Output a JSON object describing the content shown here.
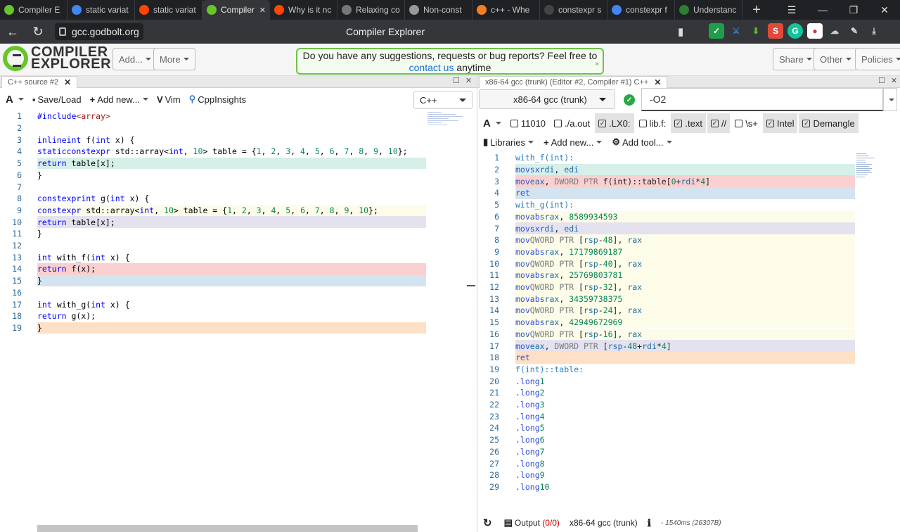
{
  "browser": {
    "tabs": [
      {
        "title": "Compiler E",
        "icon": "compiler-explorer-icon",
        "color": "#67c52a",
        "active": false
      },
      {
        "title": "static variat",
        "icon": "google-icon",
        "color": "#4285f4",
        "active": false
      },
      {
        "title": "static variat",
        "icon": "reddit-icon",
        "color": "#ff4500",
        "active": false
      },
      {
        "title": "Compiler",
        "icon": "compiler-explorer-icon",
        "color": "#67c52a",
        "active": true
      },
      {
        "title": "Why is it nc",
        "icon": "reddit-icon",
        "color": "#ff4500",
        "active": false
      },
      {
        "title": "Relaxing co",
        "icon": "isocpp-icon",
        "color": "#777777",
        "active": false
      },
      {
        "title": "Non-const",
        "icon": "document-icon",
        "color": "#999999",
        "active": false
      },
      {
        "title": "c++ - Whe",
        "icon": "stackoverflow-icon",
        "color": "#f48024",
        "active": false
      },
      {
        "title": "constexpr s",
        "icon": "github-icon",
        "color": "#444444",
        "active": false
      },
      {
        "title": "constexpr f",
        "icon": "google-icon",
        "color": "#4285f4",
        "active": false
      },
      {
        "title": "Understanc",
        "icon": "dg-icon",
        "color": "#2e7d32",
        "active": false
      }
    ],
    "url": "gcc.godbolt.org",
    "page_title": "Compiler Explorer"
  },
  "header": {
    "logo_line1": "COMPILER",
    "logo_line2": "EXPLORER",
    "add_label": "Add...",
    "more_label": "More",
    "notice_text": "Do you have any suggestions, requests or bug reports? Feel free to",
    "notice_link": "contact us",
    "notice_tail": "anytime",
    "notice_close": "×",
    "share_label": "Share",
    "other_label": "Other",
    "policies_label": "Policies"
  },
  "left": {
    "tab_title": "C++ source #2",
    "toolbar": {
      "font_label": "A",
      "save_label": "Save/Load",
      "addnew_label": "Add new...",
      "vim_label": "Vim",
      "insights_label": "CppInsights",
      "language": "C++"
    },
    "lines": [
      {
        "n": "1",
        "t": "#include <array>",
        "bg": ""
      },
      {
        "n": "2",
        "t": "",
        "bg": ""
      },
      {
        "n": "3",
        "t": "inline int f(int x) {",
        "bg": ""
      },
      {
        "n": "4",
        "t": "    static constexpr std::array<int, 10> table = {1, 2, 3, 4, 5, 6, 7, 8, 9, 10};",
        "bg": ""
      },
      {
        "n": "5",
        "t": "    return table[x];",
        "bg": "#d6efe9"
      },
      {
        "n": "6",
        "t": "}",
        "bg": ""
      },
      {
        "n": "7",
        "t": "",
        "bg": ""
      },
      {
        "n": "8",
        "t": "constexpr int g(int x) {",
        "bg": ""
      },
      {
        "n": "9",
        "t": "    constexpr std::array<int, 10> table = {1, 2, 3, 4, 5, 6, 7, 8, 9, 10};",
        "bg": "#fcfce8"
      },
      {
        "n": "10",
        "t": "    return table[x];",
        "bg": "#e4e2ef"
      },
      {
        "n": "11",
        "t": "}",
        "bg": ""
      },
      {
        "n": "12",
        "t": "",
        "bg": ""
      },
      {
        "n": "13",
        "t": "int with_f(int x) {",
        "bg": ""
      },
      {
        "n": "14",
        "t": "    return f(x);",
        "bg": "#f9d0d0"
      },
      {
        "n": "15",
        "t": "}",
        "bg": "#d3e3f0"
      },
      {
        "n": "16",
        "t": "",
        "bg": ""
      },
      {
        "n": "17",
        "t": "int with_g(int x) {",
        "bg": ""
      },
      {
        "n": "18",
        "t": "    return g(x);",
        "bg": ""
      },
      {
        "n": "19",
        "t": "}",
        "bg": "#fde0c6"
      }
    ]
  },
  "right": {
    "tab_title": "x86-64 gcc (trunk) (Editor #2, Compiler #1) C++",
    "compiler": "x86-64 gcc (trunk)",
    "options": "-O2",
    "filters": [
      {
        "label": "11010",
        "checked": false
      },
      {
        "label": "./a.out",
        "checked": false
      },
      {
        "label": ".LX0:",
        "checked": true
      },
      {
        "label": "lib.f:",
        "checked": false
      },
      {
        "label": ".text",
        "checked": true
      },
      {
        "label": "//",
        "checked": true
      },
      {
        "label": "\\s+",
        "checked": false
      },
      {
        "label": "Intel",
        "checked": true
      },
      {
        "label": "Demangle",
        "checked": true
      }
    ],
    "tools": {
      "libraries_label": "Libraries",
      "addnew_label": "Add new...",
      "addtool_label": "Add tool..."
    },
    "asm": [
      {
        "n": "1",
        "t": "with_f(int):",
        "bg": "",
        "kind": "label"
      },
      {
        "n": "2",
        "t": "        movsx   rdi, edi",
        "bg": "#d6efe9",
        "kind": "inst"
      },
      {
        "n": "3",
        "t": "        mov     eax, DWORD PTR f(int)::table[0+rdi*4]",
        "bg": "#f9d0d0",
        "kind": "inst"
      },
      {
        "n": "4",
        "t": "        ret",
        "bg": "#d3e3f0",
        "kind": "inst"
      },
      {
        "n": "5",
        "t": "with_g(int):",
        "bg": "",
        "kind": "label"
      },
      {
        "n": "6",
        "t": "        movabs  rax, 8589934593",
        "bg": "#fcfce8",
        "kind": "inst"
      },
      {
        "n": "7",
        "t": "        movsx   rdi, edi",
        "bg": "#e4e2ef",
        "kind": "inst"
      },
      {
        "n": "8",
        "t": "        mov     QWORD PTR [rsp-48], rax",
        "bg": "#fcfce8",
        "kind": "inst"
      },
      {
        "n": "9",
        "t": "        movabs  rax, 17179869187",
        "bg": "#fcfce8",
        "kind": "inst"
      },
      {
        "n": "10",
        "t": "        mov     QWORD PTR [rsp-40], rax",
        "bg": "#fcfce8",
        "kind": "inst"
      },
      {
        "n": "11",
        "t": "        movabs  rax, 25769803781",
        "bg": "#fcfce8",
        "kind": "inst"
      },
      {
        "n": "12",
        "t": "        mov     QWORD PTR [rsp-32], rax",
        "bg": "#fcfce8",
        "kind": "inst"
      },
      {
        "n": "13",
        "t": "        movabs  rax, 34359738375",
        "bg": "#fcfce8",
        "kind": "inst"
      },
      {
        "n": "14",
        "t": "        mov     QWORD PTR [rsp-24], rax",
        "bg": "#fcfce8",
        "kind": "inst"
      },
      {
        "n": "15",
        "t": "        movabs  rax, 42949672969",
        "bg": "#fcfce8",
        "kind": "inst"
      },
      {
        "n": "16",
        "t": "        mov     QWORD PTR [rsp-16], rax",
        "bg": "#fcfce8",
        "kind": "inst"
      },
      {
        "n": "17",
        "t": "        mov     eax, DWORD PTR [rsp-48+rdi*4]",
        "bg": "#e4e2ef",
        "kind": "inst"
      },
      {
        "n": "18",
        "t": "        ret",
        "bg": "#fde0c6",
        "kind": "inst"
      },
      {
        "n": "19",
        "t": "f(int)::table:",
        "bg": "",
        "kind": "label"
      },
      {
        "n": "20",
        "t": "        .long   1",
        "bg": "",
        "kind": "inst"
      },
      {
        "n": "21",
        "t": "        .long   2",
        "bg": "",
        "kind": "inst"
      },
      {
        "n": "22",
        "t": "        .long   3",
        "bg": "",
        "kind": "inst"
      },
      {
        "n": "23",
        "t": "        .long   4",
        "bg": "",
        "kind": "inst"
      },
      {
        "n": "24",
        "t": "        .long   5",
        "bg": "",
        "kind": "inst"
      },
      {
        "n": "25",
        "t": "        .long   6",
        "bg": "",
        "kind": "inst"
      },
      {
        "n": "26",
        "t": "        .long   7",
        "bg": "",
        "kind": "inst"
      },
      {
        "n": "27",
        "t": "        .long   8",
        "bg": "",
        "kind": "inst"
      },
      {
        "n": "28",
        "t": "        .long   9",
        "bg": "",
        "kind": "inst"
      },
      {
        "n": "29",
        "t": "        .long   10",
        "bg": "",
        "kind": "inst"
      }
    ],
    "status": {
      "output_label": "Output",
      "output_count": "(0/0)",
      "compiler": "x86-64 gcc (trunk)",
      "timing": "- 1540ms (26307B)"
    }
  }
}
